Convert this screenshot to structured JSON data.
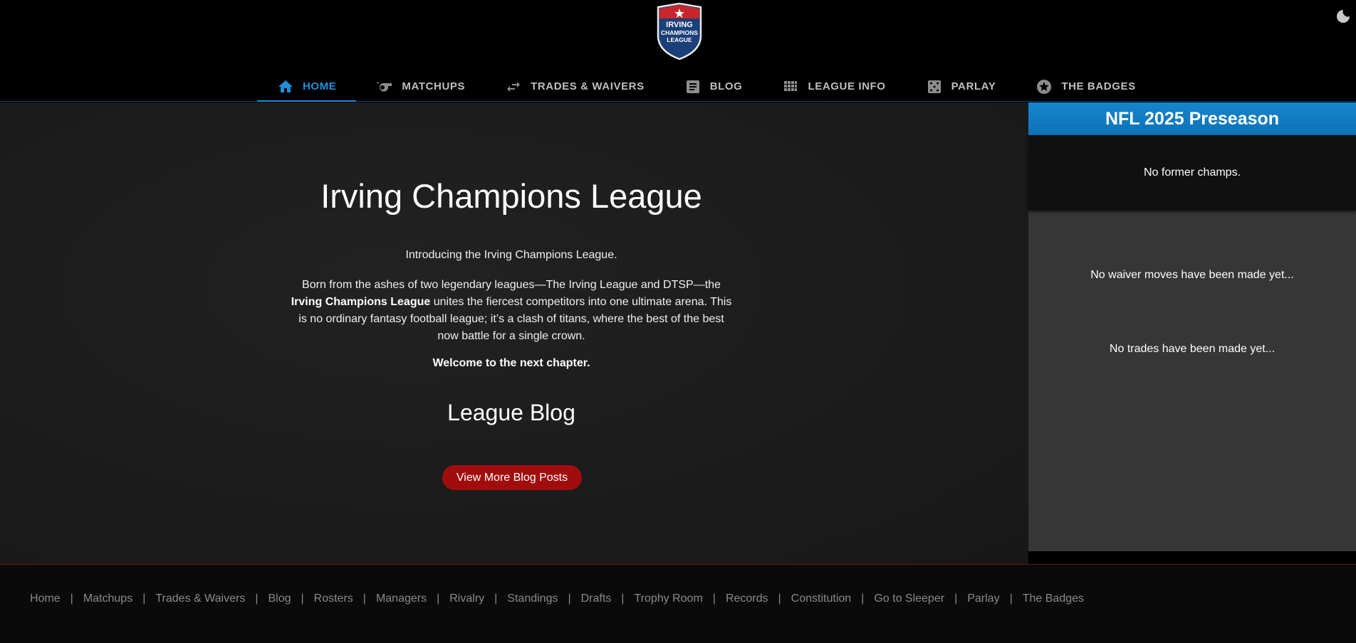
{
  "header": {
    "logo_lines": [
      "IRVING",
      "CHAMPIONS",
      "LEAGUE"
    ],
    "nav": [
      {
        "label": "HOME",
        "icon": "home-icon"
      },
      {
        "label": "MATCHUPS",
        "icon": "whistle-icon"
      },
      {
        "label": "TRADES & WAIVERS",
        "icon": "swap-icon"
      },
      {
        "label": "BLOG",
        "icon": "article-icon"
      },
      {
        "label": "LEAGUE INFO",
        "icon": "grid-icon"
      },
      {
        "label": "PARLAY",
        "icon": "dice-icon"
      },
      {
        "label": "THE BADGES",
        "icon": "star-badge-icon"
      }
    ],
    "active_tab": "HOME",
    "theme_toggle_icon": "moon-icon"
  },
  "main": {
    "title": "Irving Champions League",
    "intro": "Introducing the Irving Champions League.",
    "para_before": "Born from the ashes of two legendary leagues—The Irving League and DTSP—the ",
    "para_bold": "Irving Champions League",
    "para_after": " unites the fiercest competitors into one ultimate arena. This is no ordinary fantasy football league; it’s a clash of titans, where the best of the best now battle for a single crown.",
    "welcome": "Welcome to the next chapter.",
    "blog_heading": "League Blog",
    "blog_button": "View More Blog Posts"
  },
  "sidebar": {
    "season": "NFL 2025 Preseason",
    "champs": "No former champs.",
    "waivers": "No waiver moves have been made yet...",
    "trades": "No trades have been made yet..."
  },
  "footer": {
    "links": [
      "Home",
      "Matchups",
      "Trades & Waivers",
      "Blog",
      "Rosters",
      "Managers",
      "Rivalry",
      "Standings",
      "Drafts",
      "Trophy Room",
      "Records",
      "Constitution",
      "Go to Sleeper",
      "Parlay",
      "The Badges"
    ],
    "separator": "|"
  },
  "colors": {
    "accent": "#1e8fd9",
    "button_red": "#a10d0d",
    "season_bar": "#0c73b6"
  }
}
